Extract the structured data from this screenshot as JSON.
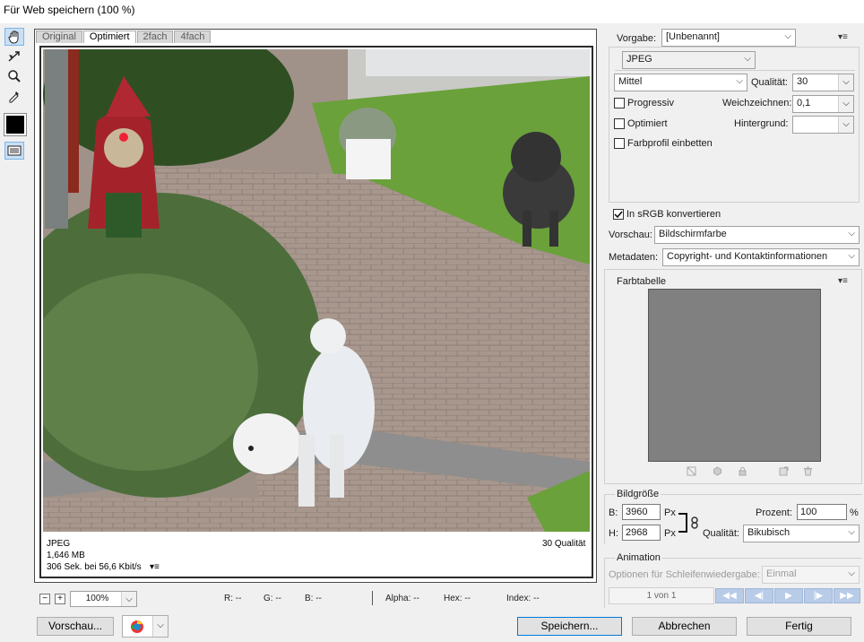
{
  "window": {
    "title": "Für Web speichern (100 %)"
  },
  "tools": [
    {
      "name": "hand-tool-icon",
      "glyph": "✋",
      "active": true
    },
    {
      "name": "slice-select-tool-icon",
      "glyph": "↗"
    },
    {
      "name": "zoom-tool-icon",
      "glyph": "🔍"
    },
    {
      "name": "eyedropper-tool-icon",
      "glyph": "✒"
    },
    {
      "name": "eyedropper-color-swatch",
      "glyph": ""
    },
    {
      "name": "toggle-slices-icon",
      "glyph": "▭",
      "active": true
    }
  ],
  "preview": {
    "tabs": [
      {
        "label": "Original",
        "active": false
      },
      {
        "label": "Optimiert",
        "active": true
      },
      {
        "label": "2fach",
        "active": false
      },
      {
        "label": "4fach",
        "active": false
      }
    ],
    "info": {
      "format": "JPEG",
      "size": "1,646 MB",
      "time": "306 Sek. bei 56,6 Kbit/s",
      "menu": "▾≡",
      "quality": "30 Qualität"
    }
  },
  "statusbar": {
    "zoom_out": "−",
    "zoom_in": "+",
    "zoom": "100%",
    "r": "R: --",
    "g": "G: --",
    "b": "B: --",
    "alpha": "Alpha: --",
    "hex": "Hex: --",
    "index": "Index: --"
  },
  "buttons": {
    "preview": "Vorschau...",
    "save": "Speichern...",
    "cancel": "Abbrechen",
    "done": "Fertig"
  },
  "settings": {
    "preset_label": "Vorgabe:",
    "preset_value": "[Unbenannt]",
    "format_value": "JPEG",
    "compression_value": "Mittel",
    "quality_label": "Qualität:",
    "quality_value": "30",
    "progressive_label": "Progressiv",
    "progressive_checked": false,
    "blur_label": "Weichzeichnen:",
    "blur_value": "0,1",
    "optimized_label": "Optimiert",
    "optimized_checked": false,
    "matte_label": "Hintergrund:",
    "matte_value": "",
    "profile_label": "Farbprofil einbetten",
    "profile_checked": false,
    "srgb_label": "In sRGB konvertieren",
    "srgb_checked": true,
    "preview_label": "Vorschau:",
    "preview_value": "Bildschirmfarbe",
    "metadata_label": "Metadaten:",
    "metadata_value": "Copyright- und Kontaktinformationen"
  },
  "color_table": {
    "title": "Farbtabelle",
    "color": "#808080"
  },
  "image_size": {
    "title": "Bildgröße",
    "w_label": "B:",
    "w_value": "3960",
    "h_label": "H:",
    "h_value": "2968",
    "unit": "Px",
    "percent_label": "Prozent:",
    "percent_value": "100",
    "percent_unit": "%",
    "quality_label": "Qualität:",
    "quality_value": "Bikubisch"
  },
  "animation": {
    "title": "Animation",
    "loop_label": "Optionen für Schleifenwiedergabe:",
    "loop_value": "Einmal",
    "frame_counter": "1 von 1"
  }
}
